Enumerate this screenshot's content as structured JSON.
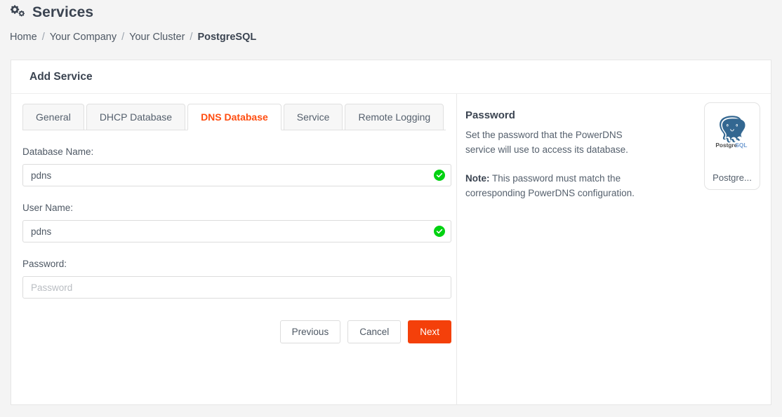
{
  "header": {
    "icon": "cogs-icon",
    "title": "Services"
  },
  "breadcrumb": {
    "items": [
      {
        "label": "Home",
        "current": false
      },
      {
        "label": "Your Company",
        "current": false
      },
      {
        "label": "Your Cluster",
        "current": false
      },
      {
        "label": "PostgreSQL",
        "current": true
      }
    ],
    "separator": "/"
  },
  "card": {
    "title": "Add Service"
  },
  "tabs": [
    {
      "label": "General",
      "active": false
    },
    {
      "label": "DHCP Database",
      "active": false
    },
    {
      "label": "DNS Database",
      "active": true
    },
    {
      "label": "Service",
      "active": false
    },
    {
      "label": "Remote Logging",
      "active": false
    }
  ],
  "form": {
    "database_name": {
      "label": "Database Name:",
      "value": "pdns",
      "placeholder": "",
      "valid": true
    },
    "user_name": {
      "label": "User Name:",
      "value": "pdns",
      "placeholder": "",
      "valid": true
    },
    "password": {
      "label": "Password:",
      "value": "",
      "placeholder": "Password",
      "valid": false
    }
  },
  "buttons": {
    "previous": "Previous",
    "cancel": "Cancel",
    "next": "Next"
  },
  "help": {
    "title": "Password",
    "line1": "Set the password that the PowerDNS",
    "line2": "service will use to access its database.",
    "note_label": "Note:",
    "note_line1": " This password must match the",
    "note_line2": "corresponding PowerDNS configuration."
  },
  "logo": {
    "name": "postgresql-logo",
    "caption": "Postgre..."
  },
  "colors": {
    "accent": "#f4400a",
    "active_tab_text": "#ff4d10",
    "valid_green": "#00d211",
    "page_bg": "#f4f4f4",
    "text": "#4e5864",
    "heading": "#3b4451"
  }
}
